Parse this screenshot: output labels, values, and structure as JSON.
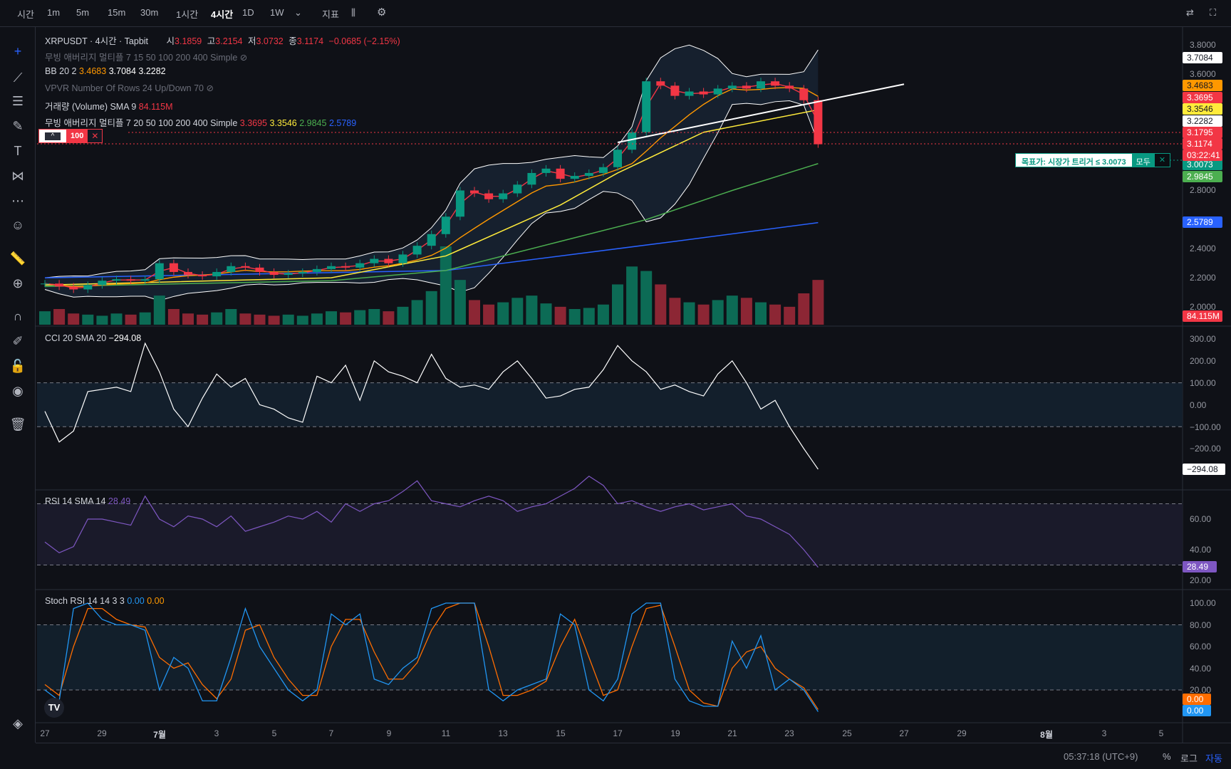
{
  "toolbar": {
    "items": [
      "시간",
      "1m",
      "5m",
      "15m",
      "30m",
      "1시간",
      "4시간",
      "1D",
      "1W"
    ],
    "active": "4시간",
    "indicators_label": "지표",
    "icons": [
      "chevron-down-icon",
      "candle-style-icon",
      "gear-icon",
      "compare-icon",
      "fullscreen-icon"
    ]
  },
  "left_toolbar": {
    "icons": [
      "crosshair-icon",
      "trendline-icon",
      "fib-icon",
      "brush-icon",
      "text-icon",
      "pattern-icon",
      "prediction-icon",
      "emoji-icon",
      "ruler-icon",
      "zoom-in-icon",
      "magnet-icon",
      "lock-drawing-icon",
      "lock-icon",
      "eye-icon",
      "trash-icon",
      "layers-icon"
    ]
  },
  "legend": {
    "symbol": "XRPUSDT · 4시간 · Tapbit",
    "ohlc": {
      "o_label": "시",
      "o": "3.1859",
      "h_label": "고",
      "h": "3.2154",
      "l_label": "저",
      "l": "3.0732",
      "c_label": "종",
      "c": "3.1174",
      "change": "−0.0685 (−2.15%)"
    },
    "ma_hidden": "무빙 애버리지 멀티플 7 15 50 100 200 400 Simple",
    "bb": {
      "label": "BB 20 2",
      "basis": "3.4683",
      "upper": "3.7084",
      "lower": "3.2282"
    },
    "vpvr": "VPVR Number Of Rows 24 Up/Down 70",
    "volume": {
      "label": "거래량 (Volume) SMA 9",
      "value": "84.115M"
    },
    "ma": {
      "label": "무빙 애버리지 멀티플 7 20 50 100 200 400 Simple",
      "v1": "3.3695",
      "v2": "3.3546",
      "v3": "2.9845",
      "v4": "2.5789"
    }
  },
  "order_widget": {
    "qty": "100"
  },
  "target_order": {
    "label": "목표가: 시장가 트리거 ≤ 3.0073",
    "all_label": "모두"
  },
  "price_axis": {
    "ticks": [
      "3.8000",
      "3.6000",
      "2.8000",
      "2.4000",
      "2.2000",
      "2.0000"
    ],
    "badges": [
      {
        "v": "3.7084",
        "bg": "#ffffff",
        "fg": "#131722"
      },
      {
        "v": "3.4683",
        "bg": "#ff9800",
        "fg": "#131722"
      },
      {
        "v": "3.3695",
        "bg": "#f23645",
        "fg": "#ffffff"
      },
      {
        "v": "3.3546",
        "bg": "#ffeb3b",
        "fg": "#131722"
      },
      {
        "v": "3.2282",
        "bg": "#ffffff",
        "fg": "#131722"
      },
      {
        "v": "3.1795",
        "bg": "#f23645",
        "fg": "#ffffff"
      },
      {
        "v": "3.1174",
        "bg": "#f23645",
        "fg": "#ffffff"
      },
      {
        "v": "3.0073",
        "bg": "#089981",
        "fg": "#ffffff"
      },
      {
        "v": "2.9845",
        "bg": "#4caf50",
        "fg": "#ffffff"
      },
      {
        "v": "2.5789",
        "bg": "#2962ff",
        "fg": "#ffffff"
      },
      {
        "v": "84.115M",
        "bg": "#f23645",
        "fg": "#ffffff"
      }
    ],
    "countdown": "03:22:41"
  },
  "cci": {
    "label": "CCI 20 SMA 20",
    "value": "−294.08",
    "ticks": [
      "300.00",
      "200.00",
      "100.00",
      "0.00",
      "−100.00",
      "−200.00"
    ]
  },
  "rsi": {
    "label": "RSI 14 SMA 14",
    "value": "28.49",
    "ticks": [
      "60.00",
      "40.00",
      "20.00"
    ]
  },
  "stoch": {
    "label": "Stoch RSI 14 14 3 3",
    "k": "0.00",
    "d": "0.00",
    "ticks": [
      "100.00",
      "80.00",
      "60.00",
      "40.00",
      "20.00"
    ]
  },
  "time_axis": [
    "27",
    "29",
    "7월",
    "3",
    "5",
    "7",
    "9",
    "11",
    "13",
    "15",
    "17",
    "19",
    "21",
    "23",
    "25",
    "27",
    "29",
    "8월",
    "3",
    "5"
  ],
  "status": {
    "clock": "05:37:18 (UTC+9)",
    "percent": "%",
    "log": "로그",
    "auto": "자동"
  },
  "colors": {
    "up": "#089981",
    "down": "#f23645",
    "ma7": "#f23645",
    "ma20": "#ff9800",
    "ma50": "#ffeb3b",
    "ma100": "#4caf50",
    "ma200": "#2962ff",
    "bb": "#ffffff",
    "cci": "#ffffff",
    "rsi": "#7e57c2",
    "stoch_k": "#2196f3",
    "stoch_d": "#ff6d00"
  },
  "chart_data": {
    "type": "candlestick",
    "symbol": "XRPUSDT",
    "interval": "4시간",
    "x_start": "06-27",
    "x_step_days": 0.5,
    "close": [
      2.16,
      2.14,
      2.12,
      2.15,
      2.18,
      2.19,
      2.18,
      2.19,
      2.3,
      2.24,
      2.22,
      2.21,
      2.24,
      2.28,
      2.27,
      2.24,
      2.22,
      2.23,
      2.24,
      2.26,
      2.28,
      2.27,
      2.3,
      2.33,
      2.3,
      2.36,
      2.42,
      2.5,
      2.62,
      2.8,
      2.78,
      2.74,
      2.78,
      2.84,
      2.92,
      2.95,
      2.88,
      2.9,
      2.92,
      2.96,
      3.08,
      3.2,
      3.55,
      3.52,
      3.45,
      3.48,
      3.46,
      3.5,
      3.52,
      3.5,
      3.55,
      3.52,
      3.5,
      3.42,
      3.1174
    ],
    "volume_m": [
      60,
      70,
      50,
      45,
      40,
      50,
      45,
      55,
      130,
      70,
      50,
      45,
      55,
      70,
      50,
      45,
      40,
      45,
      40,
      50,
      60,
      55,
      65,
      70,
      60,
      80,
      110,
      150,
      350,
      200,
      110,
      90,
      100,
      120,
      130,
      95,
      80,
      70,
      75,
      90,
      180,
      260,
      240,
      180,
      120,
      100,
      90,
      110,
      130,
      120,
      100,
      90,
      80,
      140,
      200
    ],
    "ma50": [
      [
        "06-27",
        2.15
      ],
      [
        "07-07",
        2.2
      ],
      [
        "07-11",
        2.35
      ],
      [
        "07-15",
        2.7
      ],
      [
        "07-17",
        2.92
      ],
      [
        "07-20",
        3.2
      ],
      [
        "07-24",
        3.3546
      ]
    ],
    "ma100": [
      [
        "06-27",
        2.14
      ],
      [
        "07-07",
        2.18
      ],
      [
        "07-11",
        2.25
      ],
      [
        "07-15",
        2.45
      ],
      [
        "07-18",
        2.6
      ],
      [
        "07-21",
        2.8
      ],
      [
        "07-24",
        2.9845
      ]
    ],
    "ma200": [
      [
        "06-27",
        2.2
      ],
      [
        "07-11",
        2.25
      ],
      [
        "07-15",
        2.35
      ],
      [
        "07-19",
        2.45
      ],
      [
        "07-24",
        2.5789
      ]
    ],
    "trendline": [
      [
        "07-17",
        3.13
      ],
      [
        "07-27",
        3.53
      ]
    ],
    "price_lines": [
      3.1795,
      3.1174,
      3.0073
    ],
    "ylim": [
      2.0,
      3.8
    ],
    "cci": [
      -30,
      -170,
      -120,
      60,
      70,
      80,
      60,
      280,
      150,
      -20,
      -100,
      30,
      140,
      80,
      120,
      0,
      -20,
      -60,
      -80,
      130,
      100,
      180,
      20,
      200,
      150,
      130,
      100,
      230,
      120,
      80,
      90,
      70,
      150,
      200,
      120,
      30,
      40,
      70,
      80,
      160,
      270,
      200,
      150,
      70,
      90,
      60,
      40,
      140,
      200,
      100,
      -20,
      20,
      -100,
      -200,
      -294.08
    ],
    "cci_bands": [
      100,
      -100
    ],
    "rsi": [
      45,
      38,
      42,
      60,
      60,
      58,
      56,
      75,
      60,
      55,
      62,
      60,
      55,
      62,
      52,
      55,
      58,
      62,
      60,
      65,
      58,
      70,
      65,
      70,
      72,
      78,
      85,
      72,
      70,
      68,
      72,
      75,
      72,
      65,
      68,
      70,
      75,
      80,
      88,
      82,
      70,
      72,
      68,
      65,
      68,
      70,
      66,
      68,
      70,
      62,
      60,
      55,
      50,
      40,
      28.49
    ],
    "rsi_bands": [
      70,
      30
    ],
    "stoch_k": [
      20,
      10,
      95,
      100,
      85,
      80,
      80,
      75,
      20,
      50,
      40,
      10,
      10,
      50,
      95,
      60,
      40,
      20,
      10,
      20,
      90,
      80,
      90,
      30,
      25,
      40,
      50,
      95,
      100,
      100,
      100,
      20,
      10,
      20,
      25,
      30,
      90,
      80,
      20,
      10,
      30,
      90,
      100,
      100,
      30,
      10,
      5,
      5,
      65,
      40,
      70,
      20,
      30,
      20,
      0
    ],
    "stoch_d": [
      25,
      15,
      60,
      95,
      95,
      85,
      80,
      78,
      50,
      40,
      45,
      25,
      12,
      30,
      75,
      80,
      50,
      30,
      15,
      15,
      60,
      85,
      85,
      55,
      30,
      30,
      45,
      75,
      95,
      100,
      100,
      60,
      15,
      15,
      20,
      28,
      60,
      85,
      50,
      15,
      20,
      60,
      95,
      98,
      60,
      20,
      8,
      5,
      40,
      55,
      60,
      40,
      30,
      22,
      2
    ],
    "stoch_bands": [
      80,
      20
    ]
  }
}
